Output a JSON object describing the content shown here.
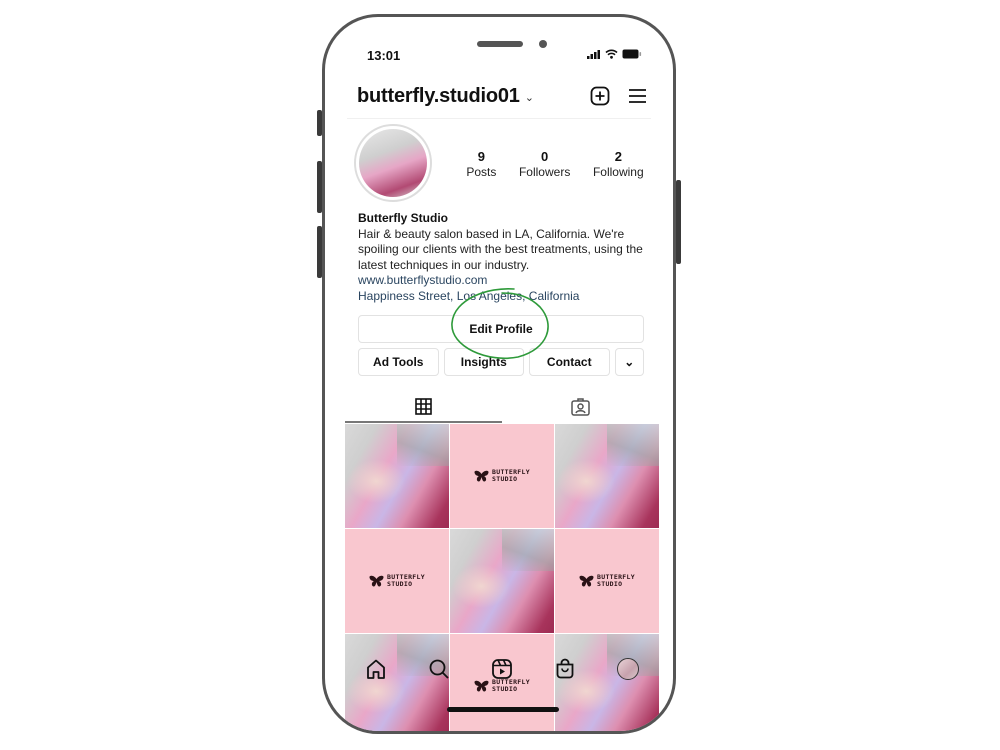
{
  "status_bar": {
    "time": "13:01"
  },
  "header": {
    "username": "butterfly.studio01",
    "chevron": "⌄",
    "icons": [
      "new-post-icon",
      "menu-icon"
    ]
  },
  "profile": {
    "stats": [
      {
        "value": "9",
        "label": "Posts"
      },
      {
        "value": "0",
        "label": "Followers"
      },
      {
        "value": "2",
        "label": "Following"
      }
    ],
    "name": "Butterfly Studio",
    "bio": "Hair & beauty salon based in LA, California. We're spoiling our clients with the best treatments, using the latest techniques in our industry.",
    "website": "www.butterflystudio.com",
    "location": "Happiness Street, Los Angeles, California"
  },
  "buttons": {
    "edit_profile": "Edit Profile",
    "ad_tools": "Ad Tools",
    "insights": "Insights",
    "contact": "Contact",
    "more": "⌄"
  },
  "annotation": {
    "highlight_color": "#2e9a3a",
    "highlighted": "Edit Profile"
  },
  "tabs": [
    {
      "name": "grid-tab",
      "icon": "grid-icon",
      "active": true
    },
    {
      "name": "tagged-tab",
      "icon": "tagged-icon",
      "active": false
    }
  ],
  "posts": {
    "logo_line1": "BUTTERFLY",
    "logo_line2": "STUDIO",
    "pattern": [
      "photo",
      "logo",
      "photo",
      "logo",
      "photo",
      "logo",
      "photo",
      "logo",
      "photo"
    ],
    "accent_pink": "#f9c7cf"
  },
  "bottom_nav": [
    "home-icon",
    "search-icon",
    "reels-icon",
    "shop-icon",
    "profile-avatar"
  ]
}
